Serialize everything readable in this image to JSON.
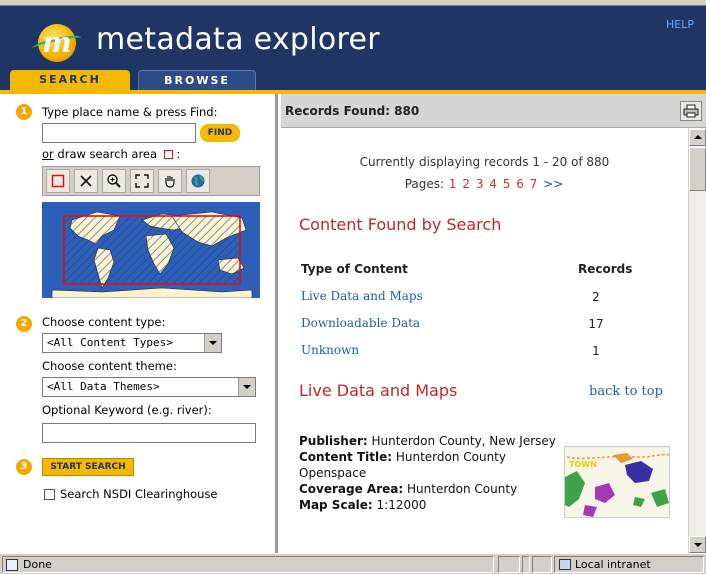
{
  "header": {
    "app_title": "metadata explorer",
    "help": "HELP",
    "logo_letter": "m"
  },
  "tabs": [
    {
      "label": "SEARCH",
      "active": true
    },
    {
      "label": "BROWSE",
      "active": false
    }
  ],
  "search_panel": {
    "step1_number": "1",
    "find_label": "Type place name & press Find:",
    "find_value": "",
    "find_button": "FIND",
    "draw_or": "or",
    "draw_label": " draw search area",
    "draw_colon": ":",
    "tools": [
      "rectangle-select-icon",
      "clear-icon",
      "zoom-in-icon",
      "full-extent-icon",
      "pan-hand-icon",
      "globe-icon"
    ],
    "step2_number": "2",
    "content_type_label": "Choose content type:",
    "content_type_value": "<All Content Types>",
    "content_theme_label": "Choose content theme:",
    "content_theme_value": "<All Data Themes>",
    "keyword_label": "Optional Keyword (e.g. river):",
    "keyword_value": "",
    "step3_number": "3",
    "start_button": "START SEARCH",
    "nsdi_label": "Search NSDI Clearinghouse",
    "nsdi_checked": false
  },
  "results": {
    "records_found": "Records Found: 880",
    "displaying": "Currently displaying records 1 - 20 of 880",
    "pages_label": "Pages:",
    "pages": [
      "1",
      "2",
      "3",
      "4",
      "5",
      "6",
      "7"
    ],
    "next": ">>",
    "content_title": "Content Found by Search",
    "table_headers": [
      "Type of Content",
      "Records"
    ],
    "rows": [
      {
        "type": "Live Data and Maps",
        "records": "2"
      },
      {
        "type": "Downloadable Data",
        "records": "17"
      },
      {
        "type": "Unknown",
        "records": "1"
      }
    ],
    "live_title": "Live Data and Maps",
    "back_to_top": "back to top",
    "record": {
      "publisher_label": "Publisher:",
      "publisher_value": " Hunterdon County, New Jersey",
      "title_label": "Content Title:",
      "title_value": " Hunterdon County Openspace",
      "coverage_label": "Coverage Area:",
      "coverage_value": " Hunterdon County",
      "scale_label": "Map Scale:",
      "scale_value": " 1:12000",
      "thumb_label": "TOWN"
    }
  },
  "status_bar": {
    "done": "Done",
    "zone": "Local intranet"
  },
  "colors": {
    "header_bg": "#1e3566",
    "accent": "#f5b800",
    "title_red": "#c0262b",
    "link_blue": "#1d5fa5"
  }
}
